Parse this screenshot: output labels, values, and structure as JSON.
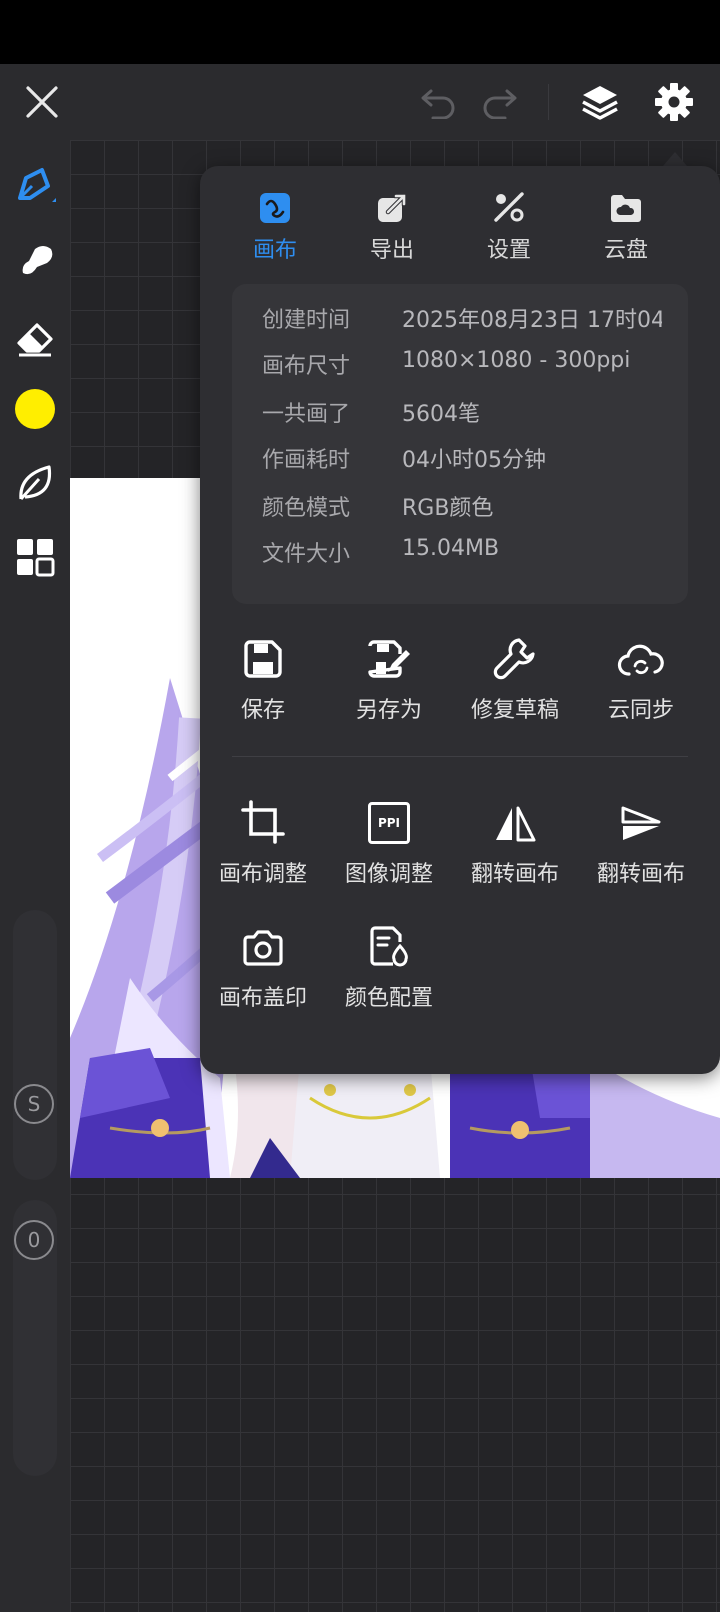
{
  "colors": {
    "accent": "#2e8ef0",
    "current_color": "#ffee00",
    "panel_bg": "#2e2e32",
    "toolbar_bg": "#2b2b2e"
  },
  "top_bar": {
    "icons": [
      "close-icon",
      "undo-icon",
      "redo-icon",
      "layers-icon",
      "gear-icon"
    ]
  },
  "left_toolbar": {
    "icons": [
      "brush-icon",
      "smudge-icon",
      "eraser-icon",
      "color-swatch",
      "leaf-icon",
      "grid-icon"
    ],
    "size_knob_label": "S",
    "opacity_knob_label": "0"
  },
  "panel": {
    "tabs": [
      {
        "label": "画布",
        "icon": "canvas-icon",
        "active": true
      },
      {
        "label": "导出",
        "icon": "export-icon",
        "active": false
      },
      {
        "label": "设置",
        "icon": "settings-icon",
        "active": false
      },
      {
        "label": "云盘",
        "icon": "cloud-drive-icon",
        "active": false
      }
    ],
    "info": [
      {
        "key": "创建时间",
        "value": "2025年08月23日 17时04分"
      },
      {
        "key": "画布尺寸",
        "value": "1080×1080 - 300ppi"
      },
      {
        "key": "一共画了",
        "value": "5604笔"
      },
      {
        "key": "作画耗时",
        "value": "04小时05分钟"
      },
      {
        "key": "颜色模式",
        "value": "RGB颜色"
      },
      {
        "key": "文件大小",
        "value": "15.04MB"
      }
    ],
    "actions_row1": [
      {
        "label": "保存",
        "icon": "save-icon"
      },
      {
        "label": "另存为",
        "icon": "save-as-icon"
      },
      {
        "label": "修复草稿",
        "icon": "wrench-icon"
      },
      {
        "label": "云同步",
        "icon": "cloud-sync-icon"
      }
    ],
    "actions_row2": [
      {
        "label": "画布调整",
        "icon": "crop-icon"
      },
      {
        "label": "图像调整",
        "icon": "ppi-icon"
      },
      {
        "label": "翻转画布",
        "icon": "flip-horizontal-icon"
      },
      {
        "label": "翻转画布",
        "icon": "flip-vertical-icon"
      }
    ],
    "actions_row3": [
      {
        "label": "画布盖印",
        "icon": "camera-icon"
      },
      {
        "label": "颜色配置",
        "icon": "color-profile-icon"
      }
    ],
    "ppi_icon_text": "PPI"
  }
}
